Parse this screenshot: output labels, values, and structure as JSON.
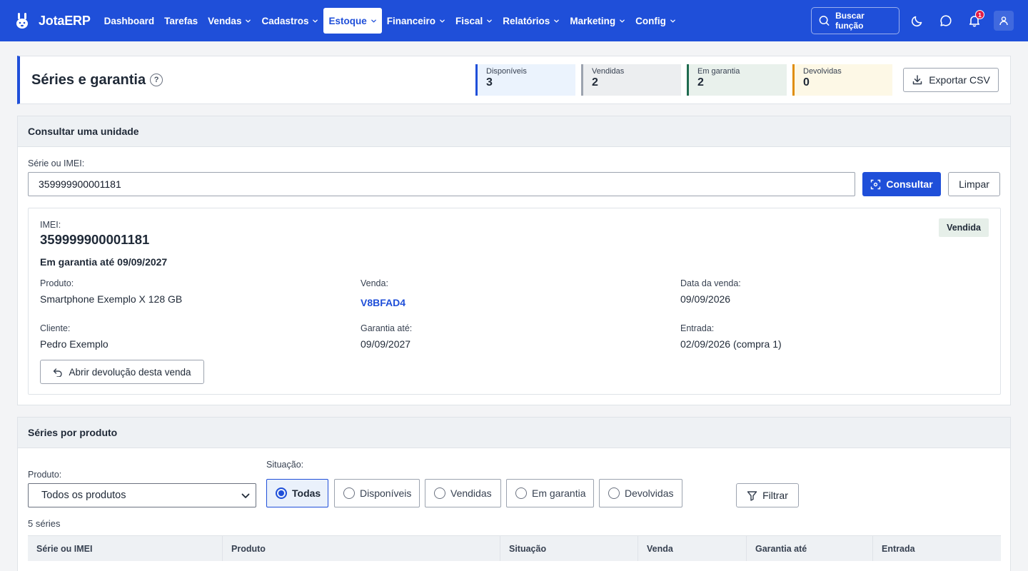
{
  "nav": {
    "brand": "JotaERP",
    "items": [
      {
        "label": "Dashboard",
        "has_chevron": false,
        "active": false
      },
      {
        "label": "Tarefas",
        "has_chevron": false,
        "active": false
      },
      {
        "label": "Vendas",
        "has_chevron": true,
        "active": false
      },
      {
        "label": "Cadastros",
        "has_chevron": true,
        "active": false
      },
      {
        "label": "Estoque",
        "has_chevron": true,
        "active": true
      },
      {
        "label": "Financeiro",
        "has_chevron": true,
        "active": false
      },
      {
        "label": "Fiscal",
        "has_chevron": true,
        "active": false
      },
      {
        "label": "Relatórios",
        "has_chevron": true,
        "active": false
      },
      {
        "label": "Marketing",
        "has_chevron": true,
        "active": false
      },
      {
        "label": "Config",
        "has_chevron": true,
        "active": false
      }
    ],
    "search_label": "Buscar função",
    "notification_count": "1",
    "icons": [
      "bunny-logo-icon",
      "search-icon",
      "moon-icon",
      "chat-icon",
      "bell-icon",
      "user-icon"
    ]
  },
  "header": {
    "title": "Séries e garantia",
    "help": "?",
    "stats": [
      {
        "label": "Disponíveis",
        "value": "3",
        "bg": "#ebf3fd",
        "border": "#1f4fd9"
      },
      {
        "label": "Vendidas",
        "value": "2",
        "bg": "#eceef0",
        "border": "#9ca3af"
      },
      {
        "label": "Em garantia",
        "value": "2",
        "bg": "#e9f1ec",
        "border": "#1f6b4f"
      },
      {
        "label": "Devolvidas",
        "value": "0",
        "bg": "#fdf8e6",
        "border": "#e08e0b"
      }
    ],
    "export_label": "Exportar CSV"
  },
  "consult": {
    "title": "Consultar uma unidade",
    "input_label": "Série ou IMEI:",
    "input_value": "359999900001181",
    "consult_label": "Consultar",
    "clear_label": "Limpar",
    "result": {
      "id_label": "IMEI:",
      "id_value": "359999900001181",
      "warranty_text": "Em garantia até 09/09/2027",
      "status": "Vendida",
      "fields": {
        "produto_label": "Produto:",
        "produto_value": "Smartphone Exemplo X 128 GB",
        "venda_label": "Venda:",
        "venda_value": "V8BFAD4",
        "data_label": "Data da venda:",
        "data_value": "09/09/2026",
        "cliente_label": "Cliente:",
        "cliente_value": "Pedro Exemplo",
        "garantia_label": "Garantia até:",
        "garantia_value": "09/09/2027",
        "entrada_label": "Entrada:",
        "entrada_value": "02/09/2026 (compra 1)"
      },
      "return_label": "Abrir devolução desta venda"
    }
  },
  "series": {
    "title": "Séries por produto",
    "produto_label": "Produto:",
    "produto_selected": "Todos os produtos",
    "situacao_label": "Situação:",
    "options": [
      {
        "label": "Todas",
        "checked": true
      },
      {
        "label": "Disponíveis",
        "checked": false
      },
      {
        "label": "Vendidas",
        "checked": false
      },
      {
        "label": "Em garantia",
        "checked": false
      },
      {
        "label": "Devolvidas",
        "checked": false
      }
    ],
    "filter_label": "Filtrar",
    "count_text": "5 séries",
    "columns": [
      "Série ou IMEI",
      "Produto",
      "Situação",
      "Venda",
      "Garantia até",
      "Entrada"
    ]
  }
}
